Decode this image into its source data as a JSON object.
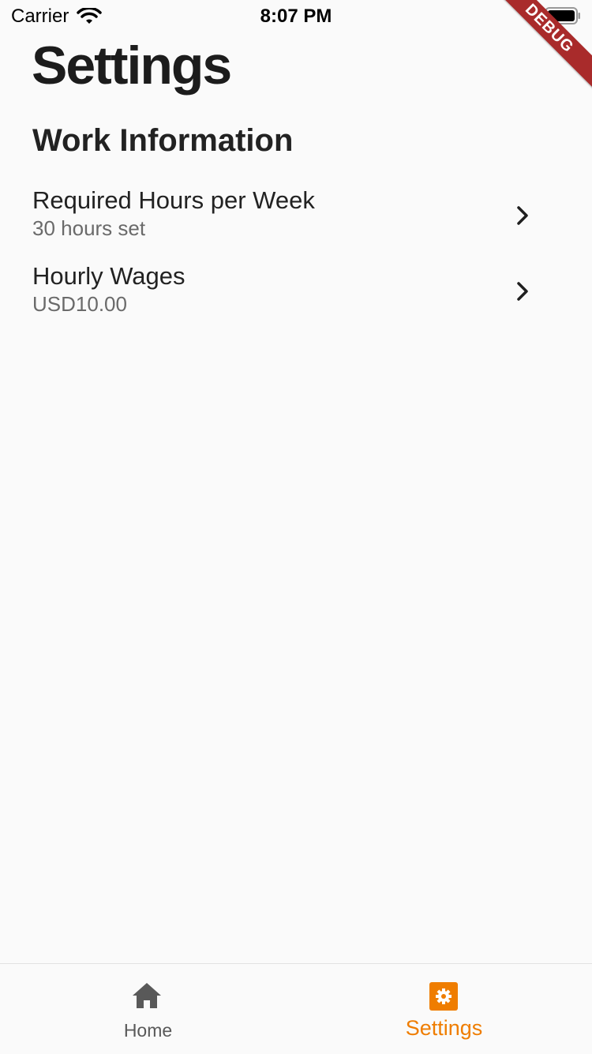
{
  "status_bar": {
    "carrier": "Carrier",
    "time": "8:07 PM",
    "wifi_icon": "wifi-icon",
    "battery_icon": "battery-icon"
  },
  "debug_banner": "DEBUG",
  "page": {
    "title": "Settings",
    "section_title": "Work Information"
  },
  "settings": {
    "items": [
      {
        "title": "Required Hours per Week",
        "subtitle": "30 hours set",
        "icon": "chevron-right-icon"
      },
      {
        "title": "Hourly Wages",
        "subtitle": "USD10.00",
        "icon": "chevron-right-icon"
      }
    ]
  },
  "tab_bar": {
    "tabs": [
      {
        "label": "Home",
        "icon": "home-icon",
        "active": false
      },
      {
        "label": "Settings",
        "icon": "gear-icon",
        "active": true
      }
    ],
    "active_color": "#ef7d00",
    "inactive_color": "#595959"
  },
  "colors": {
    "background": "#fafafa",
    "debug_banner": "#a92b2b",
    "accent": "#ef7d00"
  }
}
